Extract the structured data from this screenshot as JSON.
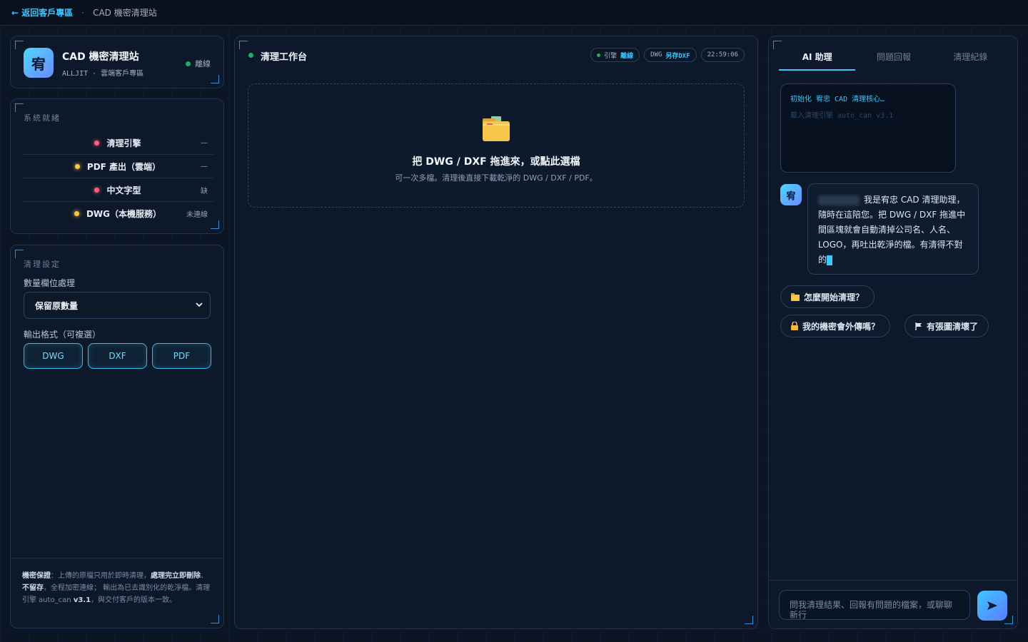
{
  "topbar": {
    "back_label": "← 返回客戶專區",
    "separator": "·",
    "current": "CAD 機密清理站"
  },
  "brand": {
    "logo_char": "宥",
    "title": "CAD 機密清理站",
    "subtitle": "ALLJIT · 雲端客戶專區",
    "status": "離線"
  },
  "system": {
    "title": "系統就緒",
    "items": [
      {
        "label": "清理引擎",
        "value": "—",
        "color": "red"
      },
      {
        "label": "PDF 產出（雲端）",
        "value": "—",
        "color": "yellow"
      },
      {
        "label": "中文字型",
        "value": "缺",
        "color": "red"
      },
      {
        "label": "DWG（本機服務）",
        "value": "未連線",
        "color": "yellow"
      }
    ]
  },
  "settings": {
    "title": "清理設定",
    "qty_label": "數量欄位處理",
    "qty_value": "保留原數量",
    "format_label": "輸出格式（可複選）",
    "formats": [
      "DWG",
      "DXF",
      "PDF"
    ],
    "notice": {
      "t1": "機密保證",
      "t2": "：上傳的原檔只用於即時清理，",
      "t3": "處理完立即刪除",
      "t4": "、",
      "t5": "不留存",
      "t6": "，全程加密連線； 輸出為已去識別化的乾淨檔。清理引擎 auto_can ",
      "t7": "v3.1",
      "t8": "，與交付客戶的版本一致。"
    }
  },
  "workspace": {
    "title": "清理工作台",
    "badge_engine_label": "引擎",
    "badge_engine_value": "離線",
    "badge_dwg_label": "DWG",
    "badge_dwg_value": "另存DXF",
    "clock": "22:59:06",
    "dropzone_title": "把 DWG / DXF 拖進來，或點此選檔",
    "dropzone_sub": "可一次多檔。清理後直接下載乾淨的 DWG / DXF / PDF。"
  },
  "assistant": {
    "tabs": [
      "AI 助理",
      "問題回報",
      "清理紀錄"
    ],
    "term_line1": "初始化 宥忠 CAD 清理核心…",
    "term_line2": "載入清理引擎 auto_can v3.1",
    "avatar_char": "宥",
    "message": "我是宥忠 CAD 清理助理，隨時在這陪您。把 DWG / DXF 拖進中間區塊就會自動清掉公司名、人名、LOGO，再吐出乾淨的檔。有清得不對的",
    "chips": [
      "怎麼開始清理？",
      "我的機密會外傳嗎？",
      "有張圖清壞了"
    ],
    "input_placeholder": "問我清理結果、回報有問題的檔案，或聊聊新行"
  },
  "colors": {
    "accent": "#3fc6ff",
    "status_red": "#ff5d7b",
    "status_yellow": "#ffc54a",
    "status_green": "#2aa86a"
  }
}
